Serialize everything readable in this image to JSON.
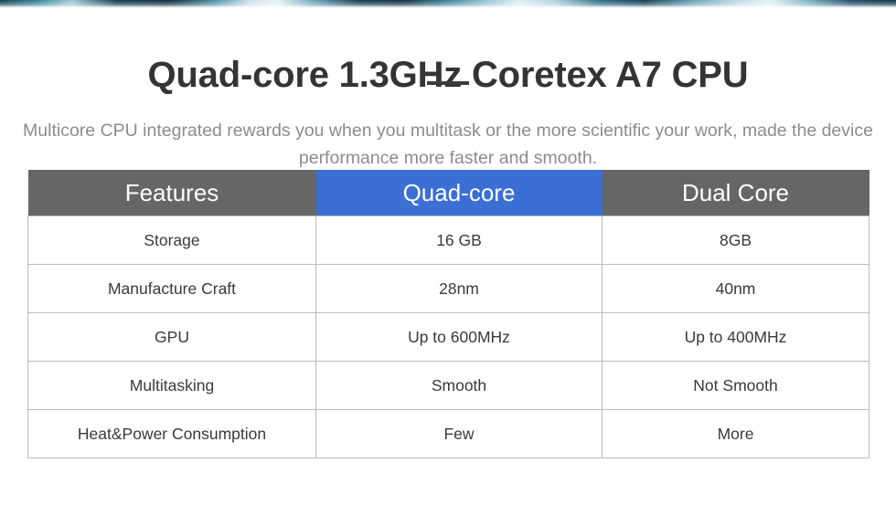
{
  "banner": {
    "name": "cropped-banner-sliver"
  },
  "header": {
    "title": "Quad-core 1.3GHz Coretex A7 CPU",
    "subtitle": "Multicore CPU integrated rewards you when you multitask or the more scientific your work, made the device performance more faster and smooth."
  },
  "colors": {
    "title": "#343434",
    "subtitle": "#8c8c8c",
    "header_gray": "#666666",
    "header_accent": "#3b6fd4",
    "accent_text": "#3a6ad0",
    "border": "#bcbcbc",
    "background": "#ffffff"
  },
  "table": {
    "columns": [
      {
        "label": "Features",
        "style": "gray"
      },
      {
        "label": "Quad-core",
        "style": "accent"
      },
      {
        "label": "Dual Core",
        "style": "gray"
      }
    ],
    "rows": [
      {
        "feature": "Storage",
        "quad_core": "16 GB",
        "dual_core": "8GB"
      },
      {
        "feature": "Manufacture Craft",
        "quad_core": "28nm",
        "dual_core": "40nm"
      },
      {
        "feature": "GPU",
        "quad_core": "Up to 600MHz",
        "dual_core": "Up to 400MHz"
      },
      {
        "feature": "Multitasking",
        "quad_core": "Smooth",
        "dual_core": "Not Smooth"
      },
      {
        "feature": "Heat&Power Consumption",
        "quad_core": "Few",
        "dual_core": "More"
      }
    ]
  }
}
